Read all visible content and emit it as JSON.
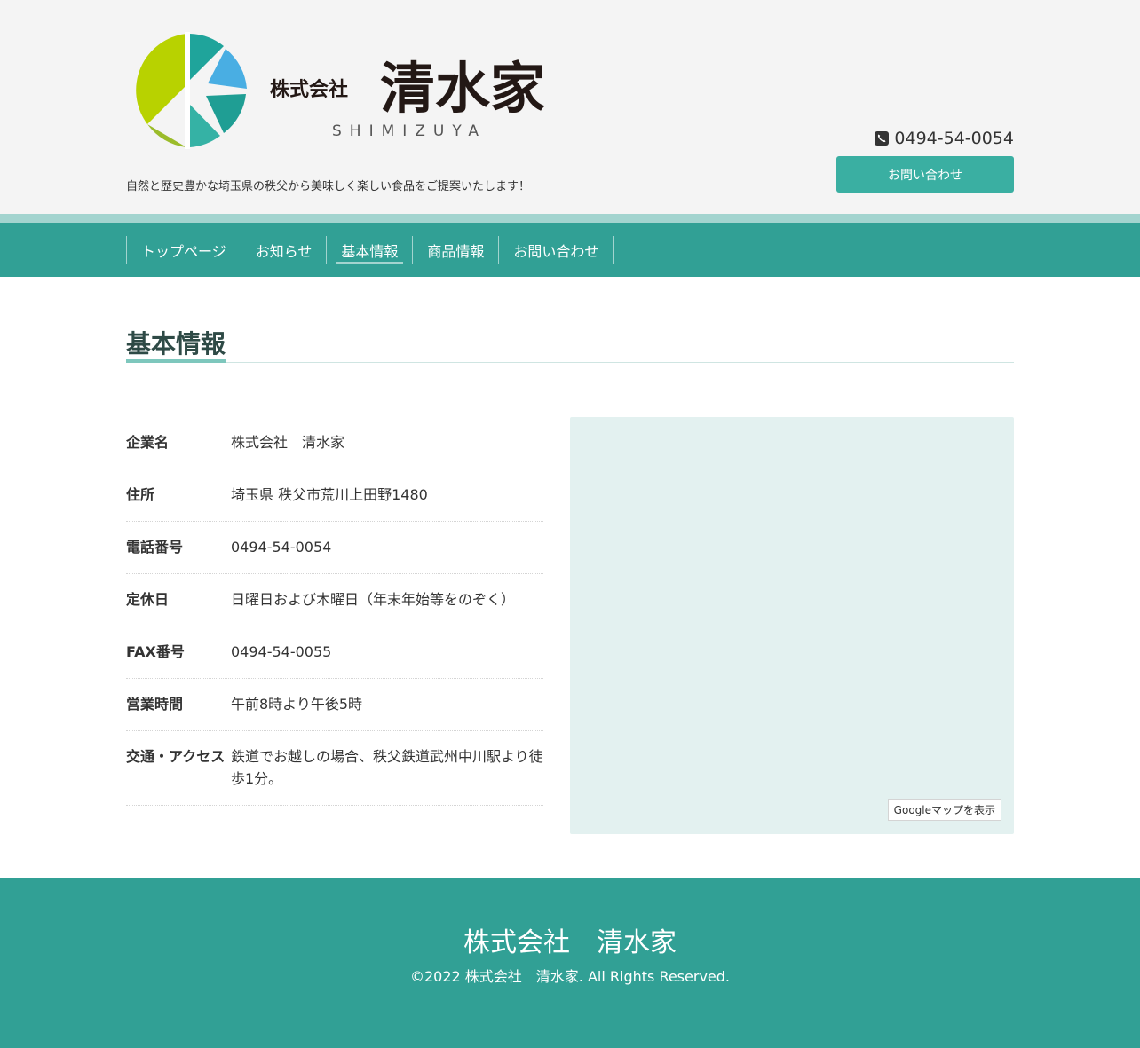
{
  "header": {
    "logo": {
      "small_text": "株式会社",
      "main_text": "清水家",
      "romaji": "SHIMIZUYA"
    },
    "tagline": "自然と歴史豊かな埼玉県の秩父から美味しく楽しい食品をご提案いたします！",
    "phone": "0494-54-0054",
    "contact_button": "お問い合わせ"
  },
  "nav": {
    "items": [
      {
        "label": "トップページ"
      },
      {
        "label": "お知らせ"
      },
      {
        "label": "基本情報"
      },
      {
        "label": "商品情報"
      },
      {
        "label": "お問い合わせ"
      }
    ],
    "active_index": 2
  },
  "main": {
    "title": "基本情報",
    "info": [
      {
        "key": "企業名",
        "value": "株式会社　清水家"
      },
      {
        "key": "住所",
        "value": "埼玉県 秩父市荒川上田野1480"
      },
      {
        "key": "電話番号",
        "value": "0494-54-0054"
      },
      {
        "key": "定休日",
        "value": "日曜日および木曜日（年末年始等をのぞく）"
      },
      {
        "key": "FAX番号",
        "value": "0494-54-0055"
      },
      {
        "key": "営業時間",
        "value": "午前8時より午後5時"
      },
      {
        "key": "交通・アクセス",
        "value": "鉄道でお越しの場合、秩父鉄道武州中川駅より徒歩1分。"
      }
    ],
    "map_button": "Googleマップを表示"
  },
  "footer": {
    "name": "株式会社　清水家",
    "copyright": "©2022 株式会社　清水家. All Rights Reserved."
  },
  "colors": {
    "accent": "#31a095",
    "accent_light": "#a3d4cf",
    "button": "#3aafa2",
    "map_bg": "#e3f1f0"
  }
}
